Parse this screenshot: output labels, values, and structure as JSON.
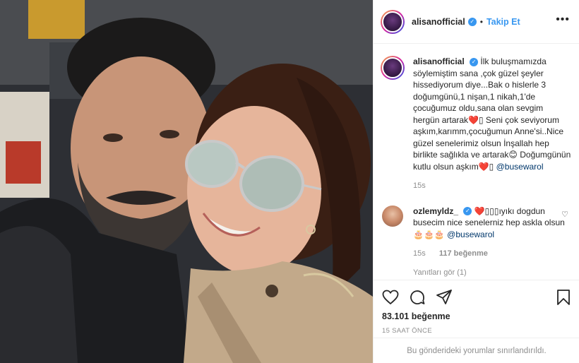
{
  "header": {
    "username": "alisanofficial",
    "verified_badge": "✓",
    "separator": "•",
    "follow_label": "Takip Et",
    "more_icon": "more-options-icon"
  },
  "caption": {
    "username": "alisanofficial",
    "text": "İlk buluşmamızda söylemiştim sana ,çok güzel şeyler hissediyorum diye...Bak o hislerle 3 doğumgünü,1 nişan,1 nikah,1'de çocuğumuz oldu,sana olan sevgim hergün artarak❤️▯ Seni çok seviyorum aşkım,karımm,çocuğumun Anne'si..Nice güzel senelerimiz olsun İnşallah hep birlikte sağlıkla ve artarak😊 Doğumgünün kutlu olsun aşkım❤️▯",
    "mention": "@busewarol",
    "timestamp": "15s"
  },
  "comment": {
    "username": "ozlemyldz_",
    "text": "❤️▯▯▯ıyıkı dogdun busecim nice senelerniz hep askla olsun 🎂🎂🎂",
    "mention": "@busewarol",
    "timestamp": "15s",
    "likes": "117 beğenme",
    "view_replies": "Yanıtları gör (1)"
  },
  "actions": {
    "icons": [
      "heart-icon",
      "comment-icon",
      "share-icon",
      "bookmark-icon"
    ],
    "likes_count": "83.101 beğenme",
    "time_ago": "15 SAAT ÖNCE"
  },
  "footer": {
    "notice": "Bu gönderideki yorumlar sınırlandırıldı."
  },
  "colors": {
    "accent": "#3897f0",
    "mention": "#00376b",
    "muted": "#8e8e8e",
    "heart": "#ed4956"
  }
}
